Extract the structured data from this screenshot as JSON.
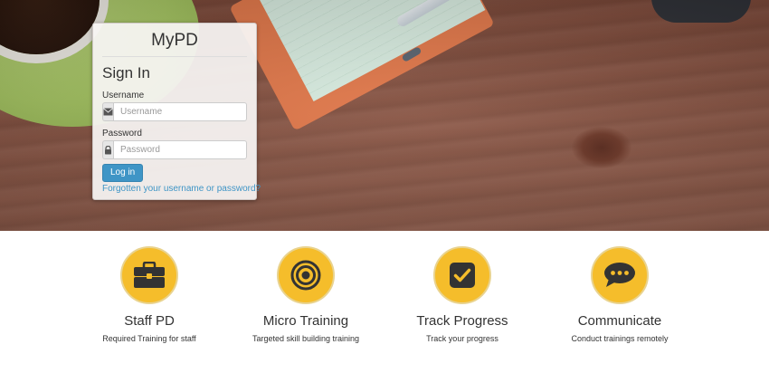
{
  "login": {
    "brand": "MyPD",
    "title": "Sign In",
    "username_label": "Username",
    "username_placeholder": "Username",
    "password_label": "Password",
    "password_placeholder": "Password",
    "login_button": "Log in",
    "forgot_link": "Forgotten your username or password?"
  },
  "features": [
    {
      "title": "Staff PD",
      "desc": "Required Training for staff",
      "icon": "briefcase-icon"
    },
    {
      "title": "Micro Training",
      "desc": "Targeted skill building training",
      "icon": "target-icon"
    },
    {
      "title": "Track Progress",
      "desc": "Track your progress",
      "icon": "checkbox-icon"
    },
    {
      "title": "Communicate",
      "desc": "Conduct trainings remotely",
      "icon": "chat-bubble-icon"
    }
  ],
  "colors": {
    "accent": "#3f95c6",
    "feature_circle": "#f5bd2b",
    "icon": "#333333"
  }
}
